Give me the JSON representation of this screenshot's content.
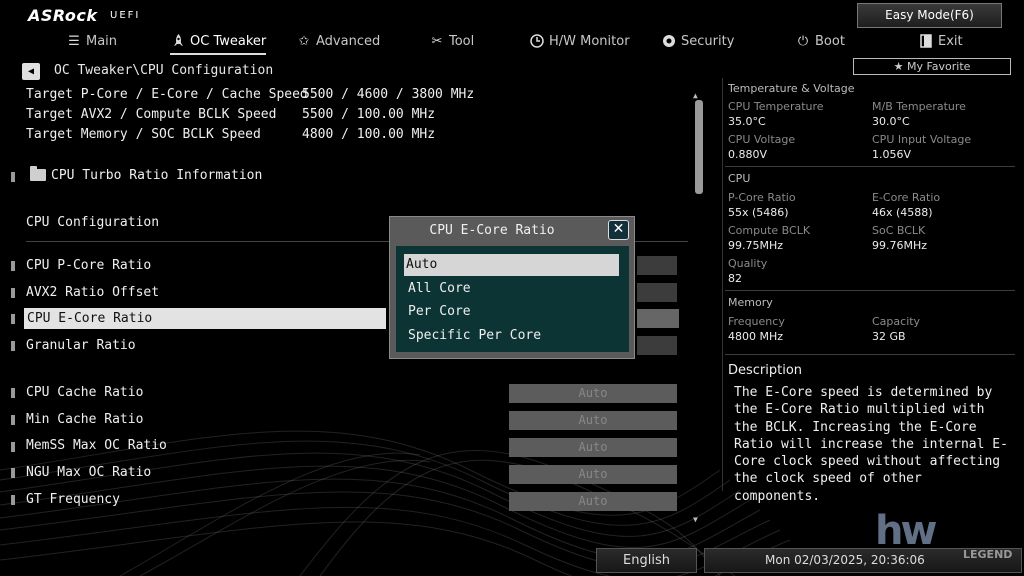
{
  "brand": {
    "logo": "ASRock",
    "sub": "UEFI"
  },
  "easy_mode_label": "Easy Mode(F6)",
  "nav": [
    {
      "label": "Main",
      "icon": "list-icon"
    },
    {
      "label": "OC Tweaker",
      "icon": "rocket-icon"
    },
    {
      "label": "Advanced",
      "icon": "star-icon"
    },
    {
      "label": "Tool",
      "icon": "wrench-icon"
    },
    {
      "label": "H/W Monitor",
      "icon": "monitor-icon"
    },
    {
      "label": "Security",
      "icon": "shield-icon"
    },
    {
      "label": "Boot",
      "icon": "power-icon"
    },
    {
      "label": "Exit",
      "icon": "exit-icon"
    }
  ],
  "favorite_label": "★ My Favorite",
  "breadcrumb": "OC Tweaker\\CPU Configuration",
  "targets": [
    {
      "label": "Target P-Core / E-Core / Cache Speed",
      "value": "5500 / 4600 / 3800 MHz"
    },
    {
      "label": "Target AVX2 / Compute BCLK Speed",
      "value": "5500 / 100.00 MHz"
    },
    {
      "label": "Target Memory / SOC BCLK Speed",
      "value": "4800 / 100.00 MHz"
    }
  ],
  "submenu_label": "CPU Turbo Ratio Information",
  "section_title": "CPU Configuration",
  "items": [
    {
      "label": "CPU P-Core Ratio"
    },
    {
      "label": "AVX2 Ratio Offset"
    },
    {
      "label": "CPU E-Core Ratio"
    },
    {
      "label": "Granular Ratio"
    },
    {
      "label": "CPU Cache  Ratio",
      "value": "Auto"
    },
    {
      "label": "Min Cache  Ratio",
      "value": "Auto"
    },
    {
      "label": "MemSS Max OC Ratio",
      "value": "Auto"
    },
    {
      "label": "NGU Max OC Ratio",
      "value": "Auto"
    },
    {
      "label": "GT Frequency",
      "value": "Auto"
    }
  ],
  "right_panel": {
    "temp_title": "Temperature & Voltage",
    "temp": [
      {
        "label": "CPU Temperature",
        "value": "35.0°C"
      },
      {
        "label": "M/B Temperature",
        "value": "30.0°C"
      },
      {
        "label": "CPU Voltage",
        "value": "0.880V"
      },
      {
        "label": "CPU Input Voltage",
        "value": "1.056V"
      }
    ],
    "cpu_title": "CPU",
    "cpu": [
      {
        "label": "P-Core Ratio",
        "value": "55x (5486)"
      },
      {
        "label": "E-Core Ratio",
        "value": "46x (4588)"
      },
      {
        "label": "Compute BCLK",
        "value": "99.75MHz"
      },
      {
        "label": "SoC BCLK",
        "value": "99.76MHz"
      },
      {
        "label": "Quality",
        "value": "82"
      }
    ],
    "mem_title": "Memory",
    "mem": [
      {
        "label": "Frequency",
        "value": "4800 MHz"
      },
      {
        "label": "Capacity",
        "value": "32 GB"
      }
    ],
    "desc_title": "Description",
    "desc_text": "The E-Core speed is determined by the E-Core Ratio multiplied with the BCLK. Increasing the E-Core Ratio will increase the internal E-Core clock speed without affecting the clock speed of other components."
  },
  "modal": {
    "title": "CPU E-Core Ratio",
    "close": "✕",
    "options": [
      "Auto",
      "All Core",
      "Per Core",
      "Specific Per Core"
    ],
    "selected_index": 0
  },
  "bottom": {
    "language": "English",
    "datetime": "Mon 02/03/2025, 20:36:06"
  },
  "watermark": {
    "big": "hw",
    "small": "LEGEND"
  },
  "colors": {
    "background": "#000000",
    "highlight": "#e3e3e3",
    "modal_list_bg": "#0d3434",
    "value_box": "#5c5c5c"
  }
}
